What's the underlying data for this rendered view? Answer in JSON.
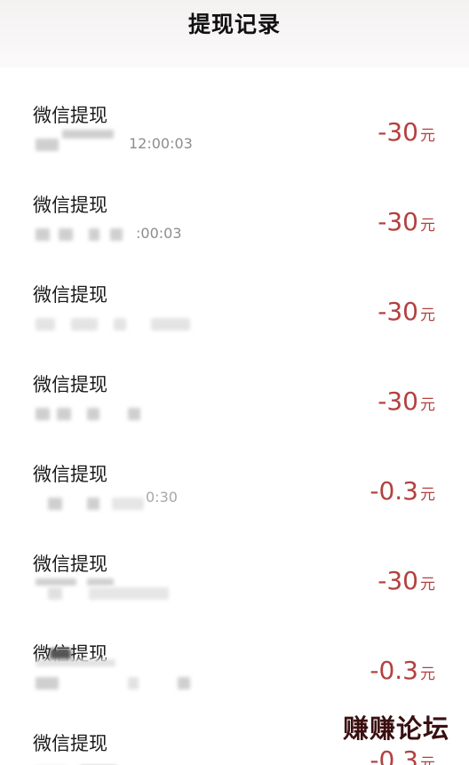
{
  "header": {
    "title": "提现记录"
  },
  "records": [
    {
      "label": "微信提现",
      "time": "12:00:03",
      "amount": "-30",
      "unit": "元"
    },
    {
      "label": "微信提现",
      "time": ":00:03",
      "amount": "-30",
      "unit": "元"
    },
    {
      "label": "微信提现",
      "time": "",
      "amount": "-30",
      "unit": "元"
    },
    {
      "label": "微信提现",
      "time": "",
      "amount": "-30",
      "unit": "元"
    },
    {
      "label": "微信提现",
      "time": "0:30",
      "amount": "-0.3",
      "unit": "元"
    },
    {
      "label": "微信提现",
      "time": "",
      "amount": "-30",
      "unit": "元"
    },
    {
      "label": "微信提现",
      "time": "",
      "amount": "-0.3",
      "unit": "元"
    },
    {
      "label": "微信提现",
      "time": "",
      "amount": "-0.3",
      "unit": "元"
    }
  ],
  "watermark": "赚赚论坛",
  "colors": {
    "amount": "#b3413f",
    "header_bg": "#f5f2f2"
  }
}
